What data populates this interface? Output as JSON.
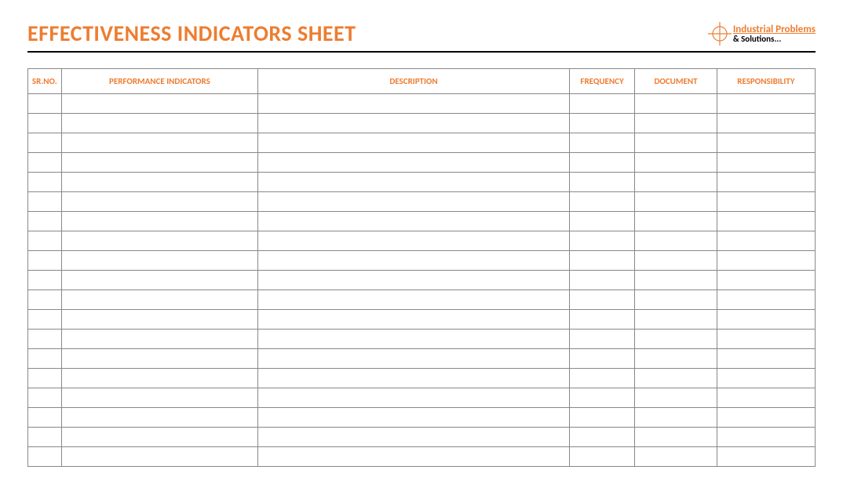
{
  "title": "EFFECTIVENESS INDICATORS SHEET",
  "logo": {
    "line1": "Industrial Problems",
    "line2": "& Solutions..."
  },
  "table": {
    "headers": {
      "srno": "SR.NO.",
      "indicators": "PERFORMANCE INDICATORS",
      "description": "DESCRIPTION",
      "frequency": "FREQUENCY",
      "document": "DOCUMENT",
      "responsibility": "RESPONSIBILITY"
    },
    "rows": [
      {
        "srno": "",
        "indicators": "",
        "description": "",
        "frequency": "",
        "document": "",
        "responsibility": ""
      },
      {
        "srno": "",
        "indicators": "",
        "description": "",
        "frequency": "",
        "document": "",
        "responsibility": ""
      },
      {
        "srno": "",
        "indicators": "",
        "description": "",
        "frequency": "",
        "document": "",
        "responsibility": ""
      },
      {
        "srno": "",
        "indicators": "",
        "description": "",
        "frequency": "",
        "document": "",
        "responsibility": ""
      },
      {
        "srno": "",
        "indicators": "",
        "description": "",
        "frequency": "",
        "document": "",
        "responsibility": ""
      },
      {
        "srno": "",
        "indicators": "",
        "description": "",
        "frequency": "",
        "document": "",
        "responsibility": ""
      },
      {
        "srno": "",
        "indicators": "",
        "description": "",
        "frequency": "",
        "document": "",
        "responsibility": ""
      },
      {
        "srno": "",
        "indicators": "",
        "description": "",
        "frequency": "",
        "document": "",
        "responsibility": ""
      },
      {
        "srno": "",
        "indicators": "",
        "description": "",
        "frequency": "",
        "document": "",
        "responsibility": ""
      },
      {
        "srno": "",
        "indicators": "",
        "description": "",
        "frequency": "",
        "document": "",
        "responsibility": ""
      },
      {
        "srno": "",
        "indicators": "",
        "description": "",
        "frequency": "",
        "document": "",
        "responsibility": ""
      },
      {
        "srno": "",
        "indicators": "",
        "description": "",
        "frequency": "",
        "document": "",
        "responsibility": ""
      },
      {
        "srno": "",
        "indicators": "",
        "description": "",
        "frequency": "",
        "document": "",
        "responsibility": ""
      },
      {
        "srno": "",
        "indicators": "",
        "description": "",
        "frequency": "",
        "document": "",
        "responsibility": ""
      },
      {
        "srno": "",
        "indicators": "",
        "description": "",
        "frequency": "",
        "document": "",
        "responsibility": ""
      },
      {
        "srno": "",
        "indicators": "",
        "description": "",
        "frequency": "",
        "document": "",
        "responsibility": ""
      },
      {
        "srno": "",
        "indicators": "",
        "description": "",
        "frequency": "",
        "document": "",
        "responsibility": ""
      },
      {
        "srno": "",
        "indicators": "",
        "description": "",
        "frequency": "",
        "document": "",
        "responsibility": ""
      },
      {
        "srno": "",
        "indicators": "",
        "description": "",
        "frequency": "",
        "document": "",
        "responsibility": ""
      }
    ]
  }
}
